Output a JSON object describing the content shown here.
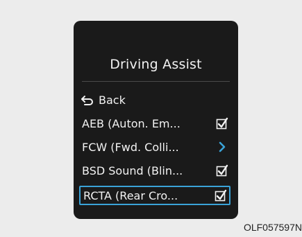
{
  "menu": {
    "title": "Driving Assist",
    "back_label": "Back",
    "items": [
      {
        "label": "AEB (Auton. Em...",
        "control": "checkbox",
        "checked": true
      },
      {
        "label": "FCW (Fwd. Colli...",
        "control": "submenu-arrow"
      },
      {
        "label": "BSD Sound (Blin...",
        "control": "checkbox",
        "checked": true
      },
      {
        "label": "RCTA (Rear Cro...",
        "control": "checkbox",
        "checked": true,
        "selected": true
      }
    ]
  },
  "footer": {
    "code": "OLF057597N"
  },
  "colors": {
    "panel": "#1a1a1a",
    "text": "#f2f2f2",
    "accent": "#3aa3d8",
    "background": "#ececec"
  }
}
